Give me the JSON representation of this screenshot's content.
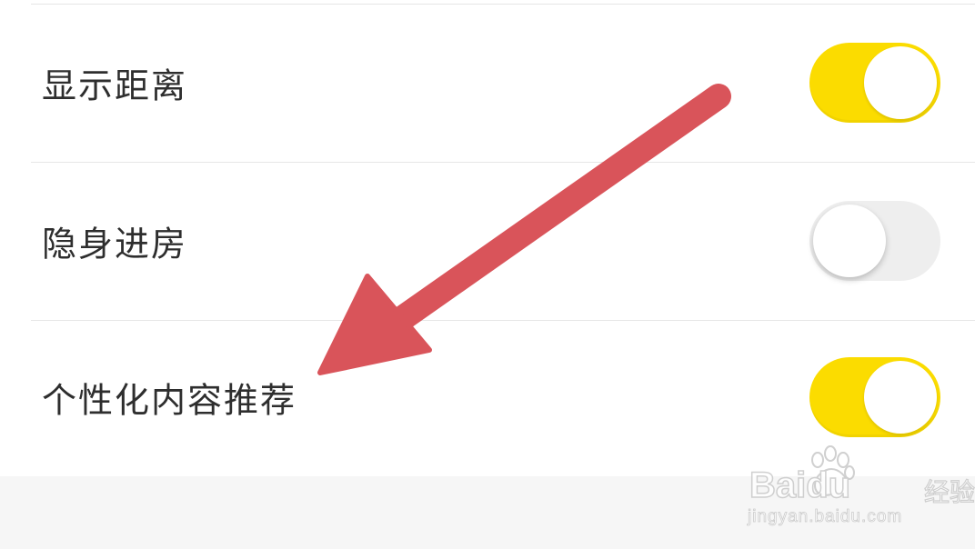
{
  "settings": [
    {
      "label": "显示距离",
      "enabled": true
    },
    {
      "label": "隐身进房",
      "enabled": false
    },
    {
      "label": "个性化内容推荐",
      "enabled": true
    }
  ],
  "colors": {
    "toggle_on": "#fbdc00",
    "toggle_off": "#eeeeee",
    "arrow": "#d9545a",
    "divider": "#e6e6e6"
  },
  "watermark": {
    "logo": "Baidu",
    "product": "经验",
    "url": "jingyan.baidu.com"
  }
}
